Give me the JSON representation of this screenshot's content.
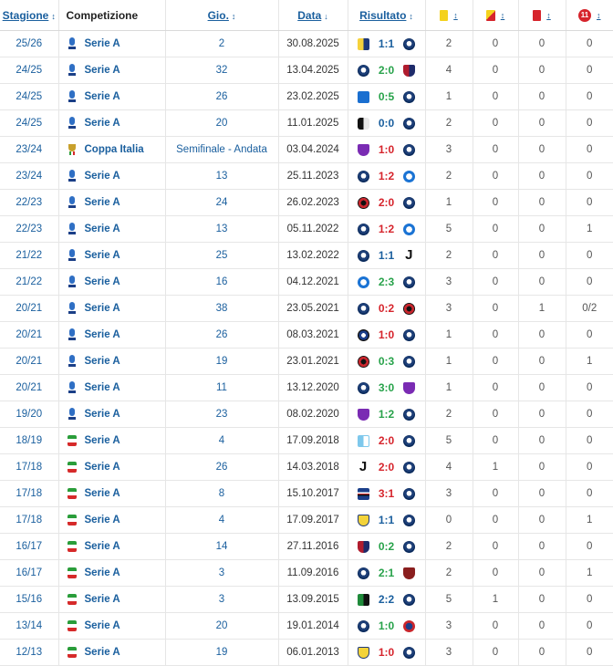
{
  "header": {
    "season": "Stagione",
    "competition": "Competizione",
    "matchday": "Gio.",
    "date": "Data",
    "result": "Risultato",
    "sort_arrow": "↕",
    "date_sort_arrow": "↓",
    "penalty_label": "11",
    "yellow_icon": "yellow-card",
    "yellowred_icon": "yellow-red-card",
    "red_icon": "red-card",
    "penalty_icon": "penalty"
  },
  "colors": {
    "link": "#1a5f9e",
    "win": "#27a24a",
    "draw": "#1a5f9e",
    "loss": "#d6242c"
  },
  "rows": [
    {
      "season": "25/26",
      "comp": "Serie A",
      "logo": "seriea",
      "md": "2",
      "date": "30.08.2025",
      "home": "parma",
      "score": "1:1",
      "outcome": "draw",
      "away": "atalanta",
      "y": "2",
      "yr": "0",
      "r": "0",
      "p": "0"
    },
    {
      "season": "24/25",
      "comp": "Serie A",
      "logo": "seriea",
      "md": "32",
      "date": "13.04.2025",
      "home": "atalanta",
      "score": "2:0",
      "outcome": "win",
      "away": "bologna",
      "y": "4",
      "yr": "0",
      "r": "0",
      "p": "0"
    },
    {
      "season": "24/25",
      "comp": "Serie A",
      "logo": "seriea",
      "md": "26",
      "date": "23.02.2025",
      "home": "empoli",
      "score": "0:5",
      "outcome": "win",
      "away": "atalanta",
      "y": "1",
      "yr": "0",
      "r": "0",
      "p": "0"
    },
    {
      "season": "24/25",
      "comp": "Serie A",
      "logo": "seriea",
      "md": "20",
      "date": "11.01.2025",
      "home": "udinese",
      "score": "0:0",
      "outcome": "draw",
      "away": "atalanta",
      "y": "2",
      "yr": "0",
      "r": "0",
      "p": "0"
    },
    {
      "season": "23/24",
      "comp": "Coppa Italia",
      "logo": "coppa",
      "md": "Semifinale - Andata",
      "date": "03.04.2024",
      "home": "fiorentina",
      "score": "1:0",
      "outcome": "loss",
      "away": "atalanta",
      "y": "3",
      "yr": "0",
      "r": "0",
      "p": "0"
    },
    {
      "season": "23/24",
      "comp": "Serie A",
      "logo": "seriea",
      "md": "13",
      "date": "25.11.2023",
      "home": "atalanta",
      "score": "1:2",
      "outcome": "loss",
      "away": "napoli",
      "y": "2",
      "yr": "0",
      "r": "0",
      "p": "0"
    },
    {
      "season": "22/23",
      "comp": "Serie A",
      "logo": "seriea",
      "md": "24",
      "date": "26.02.2023",
      "home": "milan",
      "score": "2:0",
      "outcome": "loss",
      "away": "atalanta",
      "y": "1",
      "yr": "0",
      "r": "0",
      "p": "0"
    },
    {
      "season": "22/23",
      "comp": "Serie A",
      "logo": "seriea",
      "md": "13",
      "date": "05.11.2022",
      "home": "atalanta",
      "score": "1:2",
      "outcome": "loss",
      "away": "napoli",
      "y": "5",
      "yr": "0",
      "r": "0",
      "p": "1"
    },
    {
      "season": "21/22",
      "comp": "Serie A",
      "logo": "seriea",
      "md": "25",
      "date": "13.02.2022",
      "home": "atalanta",
      "score": "1:1",
      "outcome": "draw",
      "away": "juventus",
      "y": "2",
      "yr": "0",
      "r": "0",
      "p": "0"
    },
    {
      "season": "21/22",
      "comp": "Serie A",
      "logo": "seriea",
      "md": "16",
      "date": "04.12.2021",
      "home": "napoli",
      "score": "2:3",
      "outcome": "win",
      "away": "atalanta",
      "y": "3",
      "yr": "0",
      "r": "0",
      "p": "0"
    },
    {
      "season": "20/21",
      "comp": "Serie A",
      "logo": "seriea",
      "md": "38",
      "date": "23.05.2021",
      "home": "atalanta",
      "score": "0:2",
      "outcome": "loss",
      "away": "milan",
      "y": "3",
      "yr": "0",
      "r": "1",
      "p": "0/2"
    },
    {
      "season": "20/21",
      "comp": "Serie A",
      "logo": "seriea",
      "md": "26",
      "date": "08.03.2021",
      "home": "inter",
      "score": "1:0",
      "outcome": "loss",
      "away": "atalanta",
      "y": "1",
      "yr": "0",
      "r": "0",
      "p": "0"
    },
    {
      "season": "20/21",
      "comp": "Serie A",
      "logo": "seriea",
      "md": "19",
      "date": "23.01.2021",
      "home": "milan",
      "score": "0:3",
      "outcome": "win",
      "away": "atalanta",
      "y": "1",
      "yr": "0",
      "r": "0",
      "p": "1"
    },
    {
      "season": "20/21",
      "comp": "Serie A",
      "logo": "seriea",
      "md": "11",
      "date": "13.12.2020",
      "home": "atalanta",
      "score": "3:0",
      "outcome": "win",
      "away": "fiorentina",
      "y": "1",
      "yr": "0",
      "r": "0",
      "p": "0"
    },
    {
      "season": "19/20",
      "comp": "Serie A",
      "logo": "seriea",
      "md": "23",
      "date": "08.02.2020",
      "home": "fiorentina",
      "score": "1:2",
      "outcome": "win",
      "away": "atalanta",
      "y": "2",
      "yr": "0",
      "r": "0",
      "p": "0"
    },
    {
      "season": "18/19",
      "comp": "Serie A",
      "logo": "seriea_old",
      "md": "4",
      "date": "17.09.2018",
      "home": "spal",
      "score": "2:0",
      "outcome": "loss",
      "away": "atalanta",
      "y": "5",
      "yr": "0",
      "r": "0",
      "p": "0"
    },
    {
      "season": "17/18",
      "comp": "Serie A",
      "logo": "seriea_old",
      "md": "26",
      "date": "14.03.2018",
      "home": "juventus",
      "score": "2:0",
      "outcome": "loss",
      "away": "atalanta",
      "y": "4",
      "yr": "1",
      "r": "0",
      "p": "0"
    },
    {
      "season": "17/18",
      "comp": "Serie A",
      "logo": "seriea_old",
      "md": "8",
      "date": "15.10.2017",
      "home": "sampdoria",
      "score": "3:1",
      "outcome": "loss",
      "away": "atalanta",
      "y": "3",
      "yr": "0",
      "r": "0",
      "p": "0"
    },
    {
      "season": "17/18",
      "comp": "Serie A",
      "logo": "seriea_old",
      "md": "4",
      "date": "17.09.2017",
      "home": "chievo",
      "score": "1:1",
      "outcome": "draw",
      "away": "atalanta",
      "y": "0",
      "yr": "0",
      "r": "0",
      "p": "1"
    },
    {
      "season": "16/17",
      "comp": "Serie A",
      "logo": "seriea_old",
      "md": "14",
      "date": "27.11.2016",
      "home": "bologna",
      "score": "0:2",
      "outcome": "win",
      "away": "atalanta",
      "y": "2",
      "yr": "0",
      "r": "0",
      "p": "0"
    },
    {
      "season": "16/17",
      "comp": "Serie A",
      "logo": "seriea_old",
      "md": "3",
      "date": "11.09.2016",
      "home": "atalanta",
      "score": "2:1",
      "outcome": "win",
      "away": "torino",
      "y": "2",
      "yr": "0",
      "r": "0",
      "p": "1"
    },
    {
      "season": "15/16",
      "comp": "Serie A",
      "logo": "seriea_old",
      "md": "3",
      "date": "13.09.2015",
      "home": "sassuolo",
      "score": "2:2",
      "outcome": "draw",
      "away": "atalanta",
      "y": "5",
      "yr": "1",
      "r": "0",
      "p": "0"
    },
    {
      "season": "13/14",
      "comp": "Serie A",
      "logo": "seriea_old",
      "md": "20",
      "date": "19.01.2014",
      "home": "atalanta",
      "score": "1:0",
      "outcome": "win",
      "away": "catania",
      "y": "3",
      "yr": "0",
      "r": "0",
      "p": "0"
    },
    {
      "season": "12/13",
      "comp": "Serie A",
      "logo": "seriea_old",
      "md": "19",
      "date": "06.01.2013",
      "home": "chievo",
      "score": "1:0",
      "outcome": "loss",
      "away": "atalanta",
      "y": "3",
      "yr": "0",
      "r": "0",
      "p": "0"
    }
  ]
}
